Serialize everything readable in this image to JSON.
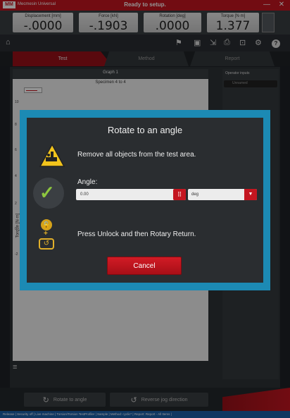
{
  "titlebar": {
    "app_name": "Mecmesin Universal",
    "status": "Ready to setup.",
    "minimize": "—",
    "close": "✕"
  },
  "readouts": [
    {
      "label": "Displacement [mm]",
      "value": "-.0000"
    },
    {
      "label": "Force [kN]",
      "value": "-.1903"
    },
    {
      "label": "Rotation [deg]",
      "value": ".0000"
    },
    {
      "label": "Torque [N·m]",
      "value": "1.377"
    }
  ],
  "tabs": [
    {
      "label": "Test"
    },
    {
      "label": "Method"
    },
    {
      "label": "Report"
    }
  ],
  "graph": {
    "title": "Graph 1",
    "specimen": "Specimen 4 to 4",
    "y_label": "Torque [N·m]",
    "ticks": [
      "10",
      "8",
      "6",
      "4",
      "2",
      "0",
      "-2"
    ]
  },
  "operator_inputs": {
    "title": "Operator inputs",
    "field_value": "Unnamed"
  },
  "bottom": {
    "rotate_label": "Rotate to angle",
    "reverse_label": "Reverse jog direction"
  },
  "status_bar": "Release | Security off | Live machine | Torsion/Torsion TestProfiler | Sample | Method: cyclic* | Report: Report - All Items |",
  "dialog": {
    "title": "Rotate to an angle",
    "message1": "Remove all objects from the test area.",
    "angle_label": "Angle:",
    "angle_value": "0.00",
    "unit_value": "deg",
    "message2": "Press Unlock and then Rotary Return.",
    "cancel_label": "Cancel"
  }
}
